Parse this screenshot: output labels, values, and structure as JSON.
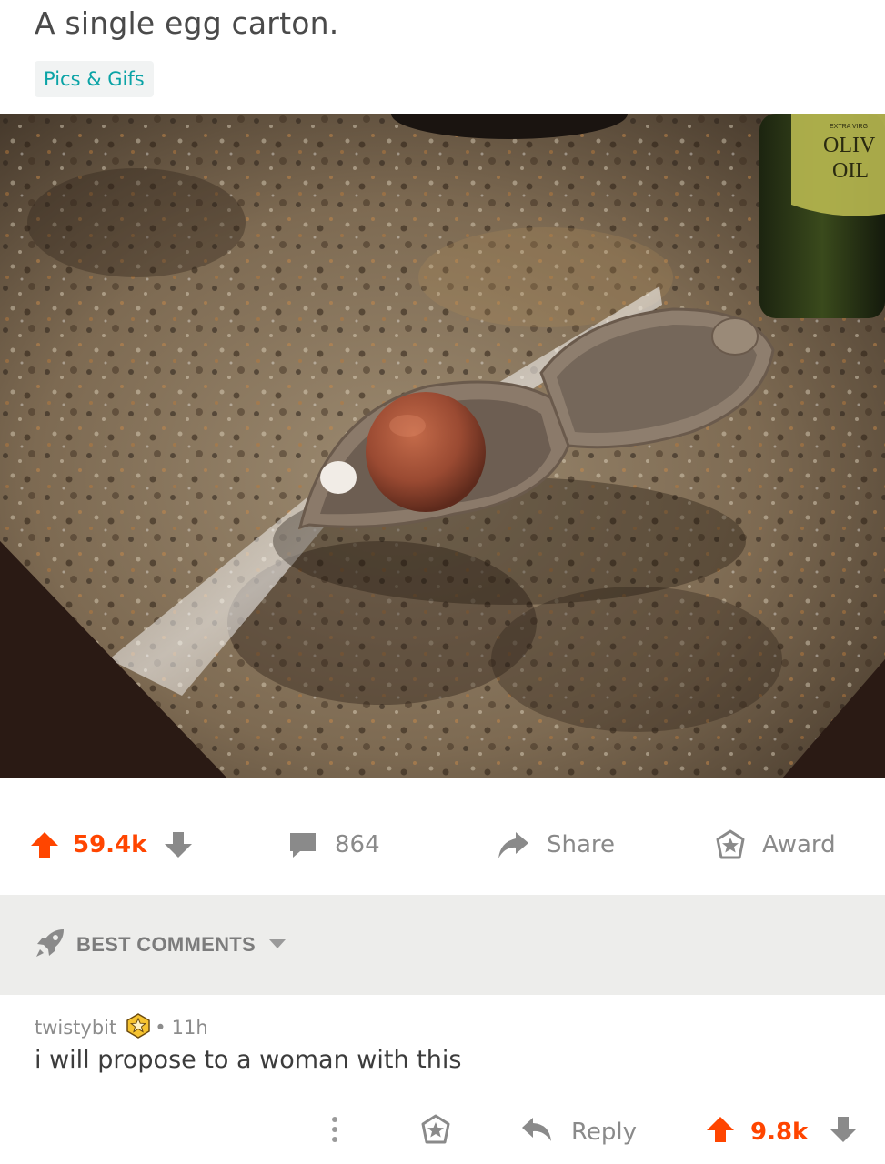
{
  "post": {
    "title": "A single egg carton.",
    "flair": "Pics & Gifs",
    "image": {
      "alt_label": "egg-carton-photo",
      "bottle_label_line1": "OLIV",
      "bottle_label_line2": "OIL",
      "bottle_label_top": "EXTRA VIRG"
    }
  },
  "actions": {
    "vote_count": "59.4k",
    "comments_count": "864",
    "share_label": "Share",
    "award_label": "Award"
  },
  "sort": {
    "label": "BEST COMMENTS"
  },
  "comment": {
    "author": "twistybit",
    "age": "11h",
    "separator": "•",
    "body": "i will propose to a woman with this",
    "reply_label": "Reply",
    "vote_count": "9.8k"
  },
  "colors": {
    "upvote": "#ff4500",
    "flair_text": "#0aa3a6",
    "muted": "#8a8a8a",
    "sort_bar_bg": "#ededeb"
  }
}
